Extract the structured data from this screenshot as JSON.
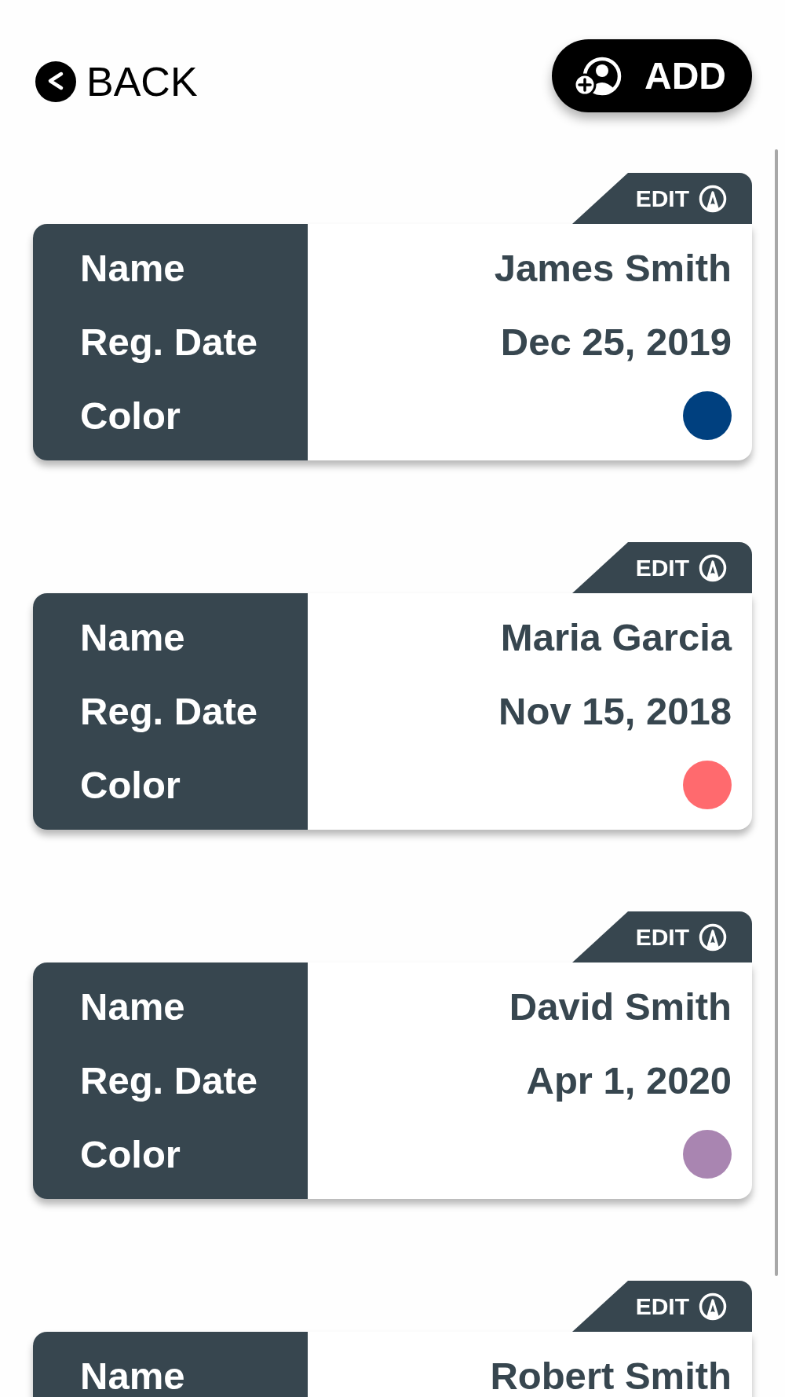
{
  "header": {
    "back_label": "BACK",
    "add_label": "ADD"
  },
  "cards": [
    {
      "edit_label": "EDIT",
      "fields": [
        {
          "kind": "text",
          "label": "Name",
          "value": "James Smith"
        },
        {
          "kind": "text",
          "label": "Reg. Date",
          "value": "Dec 25, 2019"
        },
        {
          "kind": "color",
          "label": "Color",
          "color": "#00407f"
        }
      ]
    },
    {
      "edit_label": "EDIT",
      "fields": [
        {
          "kind": "text",
          "label": "Name",
          "value": "Maria Garcia"
        },
        {
          "kind": "text",
          "label": "Reg. Date",
          "value": "Nov 15, 2018"
        },
        {
          "kind": "color",
          "label": "Color",
          "color": "#ff6a6e"
        }
      ]
    },
    {
      "edit_label": "EDIT",
      "fields": [
        {
          "kind": "text",
          "label": "Name",
          "value": "David Smith"
        },
        {
          "kind": "text",
          "label": "Reg. Date",
          "value": "Apr 1, 2020"
        },
        {
          "kind": "color",
          "label": "Color",
          "color": "#a985b1"
        }
      ]
    },
    {
      "edit_label": "EDIT",
      "fields": [
        {
          "kind": "text",
          "label": "Name",
          "value": "Robert Smith"
        }
      ]
    }
  ]
}
